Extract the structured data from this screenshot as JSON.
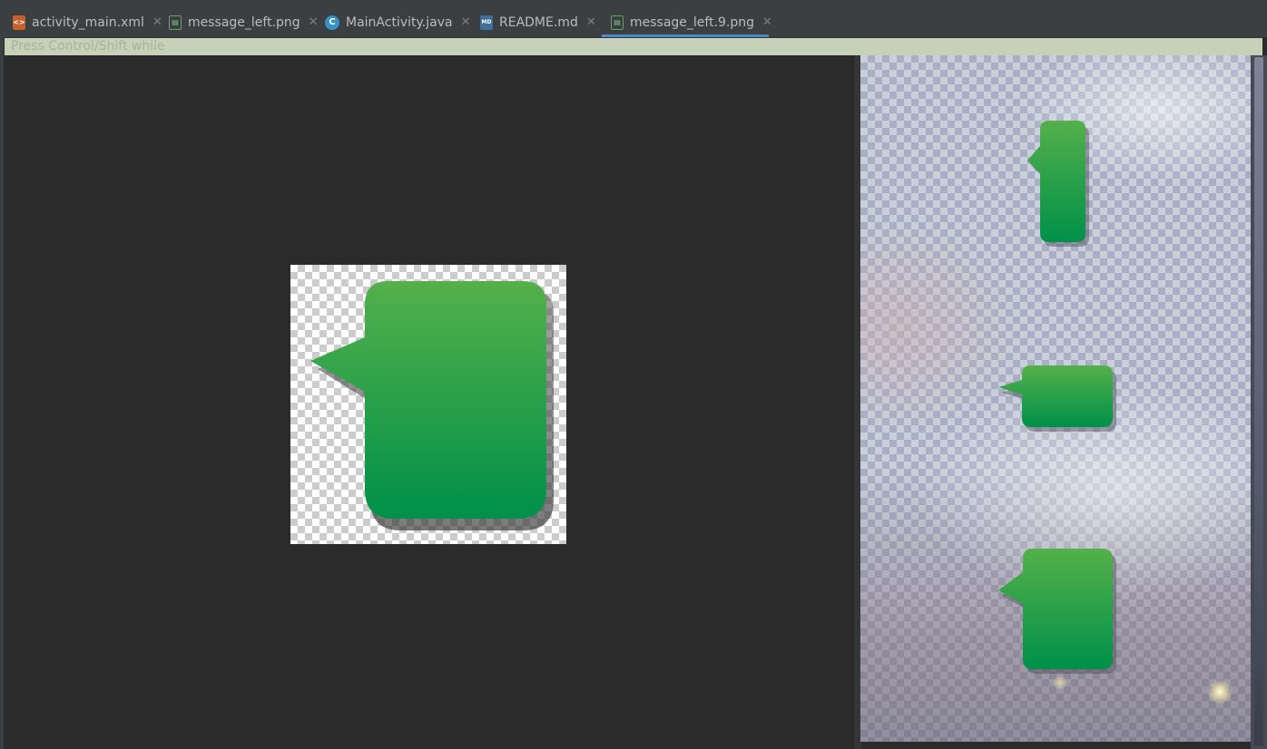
{
  "tabs": [
    {
      "label": "activity_main.xml",
      "icon": "xml-file-icon",
      "active": false
    },
    {
      "label": "message_left.png",
      "icon": "image-file-icon",
      "active": false
    },
    {
      "label": "MainActivity.java",
      "icon": "java-class-icon",
      "active": false
    },
    {
      "label": "README.md",
      "icon": "markdown-file-icon",
      "active": false
    },
    {
      "label": "message_left.9.png",
      "icon": "image-file-icon",
      "active": true
    }
  ],
  "info_bar": {
    "text": "Press Control/Shift while"
  },
  "colors": {
    "bubble_top": "#54b04a",
    "bubble_bottom": "#00904a",
    "active_tab_underline": "#4a88c7",
    "editor_bg": "#2b2b2b"
  }
}
